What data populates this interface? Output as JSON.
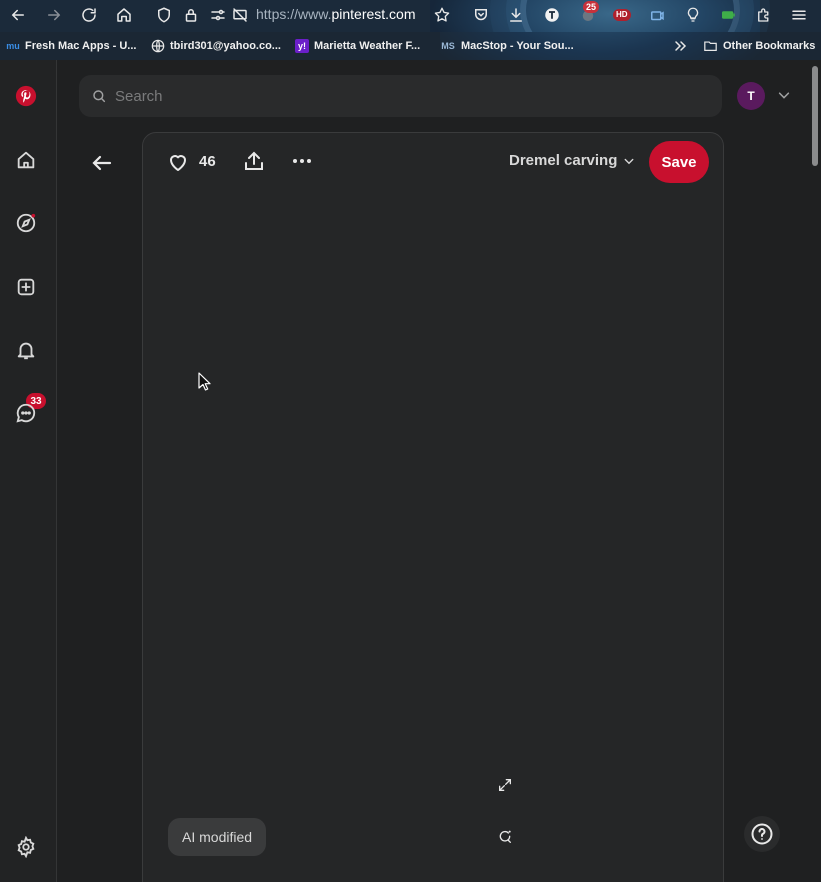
{
  "browser": {
    "url_prefix": "https://www.",
    "url_domain": "pinterest.com",
    "extension_badge": "25",
    "hd_label": "HD",
    "bookmarks": [
      {
        "label": "Fresh Mac Apps - U...",
        "favicon": "mu"
      },
      {
        "label": "tbird301@yahoo.co...",
        "favicon": "globe"
      },
      {
        "label": "Marietta Weather F...",
        "favicon": "y!"
      },
      {
        "label": "MacStop - Your Sou...",
        "favicon": "MS"
      }
    ],
    "other_bookmarks": "Other Bookmarks"
  },
  "rail": {
    "notification_count": "33"
  },
  "header": {
    "search_placeholder": "Search",
    "avatar_initial": "T"
  },
  "pin": {
    "like_count": "46",
    "board_name": "Dremel carving",
    "save_label": "Save",
    "ai_badge": "AI modified"
  },
  "colors": {
    "brand_red": "#c8102e",
    "background": "#1f2021",
    "card": "#252627"
  }
}
